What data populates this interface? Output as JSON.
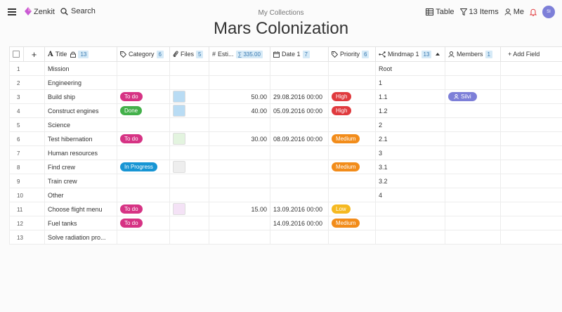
{
  "app": {
    "brand": "Zenkit",
    "search_label": "Search"
  },
  "breadcrumb": "My Collections",
  "title": "Mars Colonization",
  "toolbar": {
    "view_label": "Table",
    "filter_label": "13 Items",
    "user_label": "Me",
    "avatar_initials": "SI"
  },
  "columns": {
    "title": {
      "label": "Title",
      "count": "13"
    },
    "category": {
      "label": "Category",
      "count": "6"
    },
    "files": {
      "label": "Files",
      "count": "5"
    },
    "estimate": {
      "label": "Esti...",
      "sum": "∑ 335.00"
    },
    "date": {
      "label": "Date 1",
      "count": "7"
    },
    "priority": {
      "label": "Priority",
      "count": "6"
    },
    "mindmap": {
      "label": "Mindmap 1",
      "count": "13"
    },
    "members": {
      "label": "Members",
      "count": "1"
    },
    "add": {
      "label": "+ Add Field"
    }
  },
  "colors": {
    "todo": "#d63384",
    "done": "#43b04a",
    "inprogress": "#1795d4",
    "high": "#e03a3e",
    "medium": "#f28c1a",
    "low": "#f5b921",
    "member": "#7d7fd8",
    "brand": "#c95ad4"
  },
  "rows": [
    {
      "n": "1",
      "title": "Mission",
      "category": null,
      "file": null,
      "estimate": "",
      "date": "",
      "priority": null,
      "mindmap": "Root",
      "member": null
    },
    {
      "n": "2",
      "title": "Engineering",
      "category": null,
      "file": null,
      "estimate": "",
      "date": "",
      "priority": null,
      "mindmap": "1",
      "member": null
    },
    {
      "n": "3",
      "title": "Build ship",
      "category": {
        "label": "To do",
        "color": "todo"
      },
      "file": "#b9dcf4",
      "estimate": "50.00",
      "date": "29.08.2016 00:00",
      "priority": {
        "label": "High",
        "color": "high"
      },
      "mindmap": "1.1",
      "member": "Silvi"
    },
    {
      "n": "4",
      "title": "Construct engines",
      "category": {
        "label": "Done",
        "color": "done"
      },
      "file": "#b9dcf4",
      "estimate": "40.00",
      "date": "05.09.2016 00:00",
      "priority": {
        "label": "High",
        "color": "high"
      },
      "mindmap": "1.2",
      "member": null
    },
    {
      "n": "5",
      "title": "Science",
      "category": null,
      "file": null,
      "estimate": "",
      "date": "",
      "priority": null,
      "mindmap": "2",
      "member": null
    },
    {
      "n": "6",
      "title": "Test hibernation",
      "category": {
        "label": "To do",
        "color": "todo"
      },
      "file": "#e3f4df",
      "estimate": "30.00",
      "date": "08.09.2016 00:00",
      "priority": {
        "label": "Medium",
        "color": "medium"
      },
      "mindmap": "2.1",
      "member": null
    },
    {
      "n": "7",
      "title": "Human resources",
      "category": null,
      "file": null,
      "estimate": "",
      "date": "",
      "priority": null,
      "mindmap": "3",
      "member": null
    },
    {
      "n": "8",
      "title": "Find crew",
      "category": {
        "label": "In Progress",
        "color": "inprogress"
      },
      "file": "#eeeeee",
      "estimate": "",
      "date": "",
      "priority": {
        "label": "Medium",
        "color": "medium"
      },
      "mindmap": "3.1",
      "member": null
    },
    {
      "n": "9",
      "title": "Train crew",
      "category": null,
      "file": null,
      "estimate": "",
      "date": "",
      "priority": null,
      "mindmap": "3.2",
      "member": null
    },
    {
      "n": "10",
      "title": "Other",
      "category": null,
      "file": null,
      "estimate": "",
      "date": "",
      "priority": null,
      "mindmap": "4",
      "member": null
    },
    {
      "n": "11",
      "title": "Choose flight menu",
      "category": {
        "label": "To do",
        "color": "todo"
      },
      "file": "#f4e2f6",
      "estimate": "15.00",
      "date": "13.09.2016 00:00",
      "priority": {
        "label": "Low",
        "color": "low"
      },
      "mindmap": "",
      "member": null
    },
    {
      "n": "12",
      "title": "Fuel tanks",
      "category": {
        "label": "To do",
        "color": "todo"
      },
      "file": null,
      "estimate": "",
      "date": "14.09.2016 00:00",
      "priority": {
        "label": "Medium",
        "color": "medium"
      },
      "mindmap": "",
      "member": null
    },
    {
      "n": "13",
      "title": "Solve radiation pro...",
      "category": null,
      "file": null,
      "estimate": "",
      "date": "",
      "priority": null,
      "mindmap": "",
      "member": null
    }
  ]
}
